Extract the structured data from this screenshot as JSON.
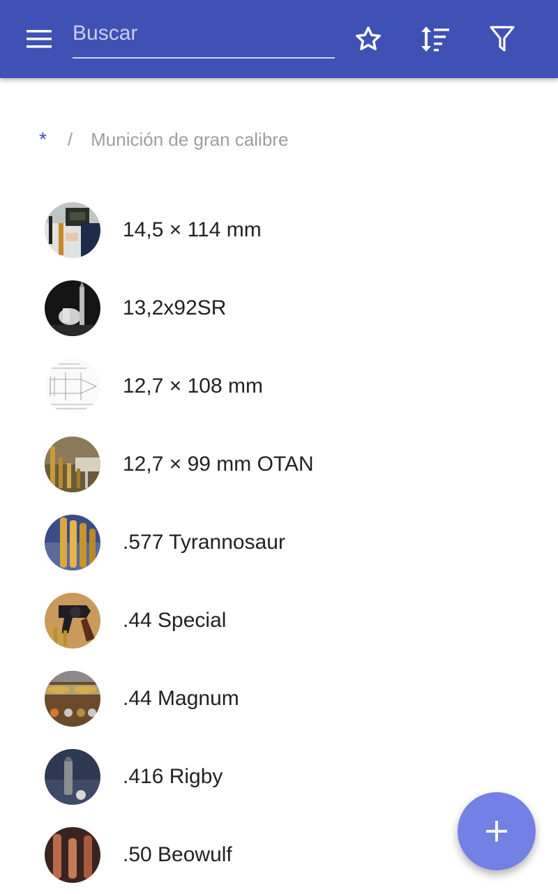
{
  "theme": {
    "primary": "#3f51b5",
    "fab": "#7381e4",
    "text": "#212121",
    "muted": "#9e9e9e"
  },
  "toolbar": {
    "menu_icon": "menu-icon",
    "search_placeholder": "Buscar",
    "favorite_icon": "star-outline-icon",
    "sort_icon": "sort-icon",
    "filter_icon": "filter-icon"
  },
  "breadcrumb": {
    "root": "*",
    "separator": "/",
    "current": "Munición de gran calibre"
  },
  "items": [
    {
      "label": "14,5 × 114 mm"
    },
    {
      "label": "13,2x92SR"
    },
    {
      "label": "12,7 × 108 mm"
    },
    {
      "label": "12,7 × 99 mm OTAN"
    },
    {
      "label": ".577 Tyrannosaur"
    },
    {
      "label": ".44 Special"
    },
    {
      "label": ".44 Magnum"
    },
    {
      "label": ".416 Rigby"
    },
    {
      "label": ".50 Beowulf"
    }
  ],
  "fab": {
    "icon": "plus-icon"
  }
}
